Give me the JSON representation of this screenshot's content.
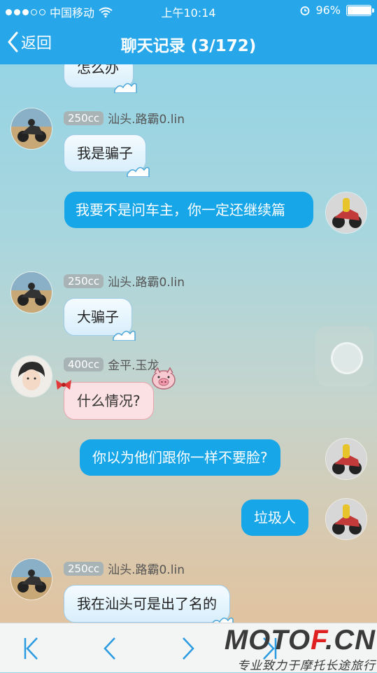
{
  "status_bar": {
    "carrier": "中国移动",
    "time": "上午10:14",
    "battery": "96%",
    "battery_level": 0.96
  },
  "nav": {
    "back_label": "返回",
    "title": "聊天记录 (3/172)"
  },
  "messages": [
    {
      "side": "left",
      "text": "怎么办"
    },
    {
      "side": "left",
      "badge": "250cc",
      "sender": "汕头.路霸0.lin",
      "text": "我是骗子"
    },
    {
      "side": "right",
      "text": "我要不是问车主，你一定还继续篇"
    },
    {
      "side": "left",
      "badge": "250cc",
      "sender": "汕头.路霸0.lin",
      "text": "大骗子"
    },
    {
      "side": "left",
      "badge": "400cc",
      "sender": "金平.玉龙",
      "text": "什么情况?"
    },
    {
      "side": "right",
      "text": "你以为他们跟你一样不要脸?"
    },
    {
      "side": "right",
      "text": "垃圾人"
    },
    {
      "side": "left",
      "badge": "250cc",
      "sender": "汕头.路霸0.lin",
      "text": "我在汕头可是出了名的"
    }
  ],
  "toolbar": {
    "first": "first-page-icon",
    "prev": "previous-page-icon",
    "next": "next-page-icon",
    "last": "last-page-icon"
  },
  "watermark": {
    "logo_a": "MOTO",
    "logo_b": "F",
    "logo_c": ".CN",
    "slogan": "专业致力于摩托长途旅行"
  },
  "colors": {
    "accent": "#27a7ea",
    "outgoing_bubble": "#17a6e8",
    "incoming_bubble": "#e3f3fd",
    "pink_bubble": "#fbe1e3"
  }
}
